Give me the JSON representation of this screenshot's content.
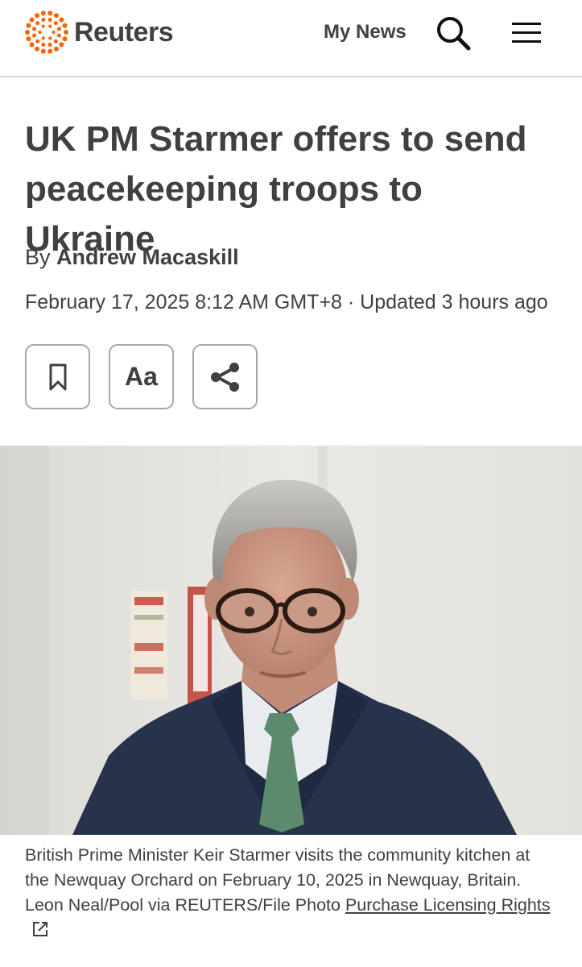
{
  "header": {
    "logo_text": "Reuters",
    "logo_icon": "reuters-dot-logo-icon",
    "my_news_label": "My News",
    "search_icon": "search-icon",
    "menu_icon": "hamburger-menu-icon"
  },
  "article": {
    "headline": "UK PM Starmer offers to send peacekeeping troops to Ukraine",
    "byline_prefix": "By",
    "author": "Andrew Macaskill",
    "date": "February 17, 2025 8:12 AM GMT+8 · Updated 3 hours ago"
  },
  "actions": {
    "bookmark_icon": "bookmark-icon",
    "text_size_label": "Aa",
    "share_icon": "share-icon"
  },
  "photo": {
    "caption": "British Prime Minister Keir Starmer visits the community kitchen at the Newquay Orchard on February 10, 2025 in Newquay, Britain. Leon Neal/Pool via REUTERS/File Photo",
    "licensing_link_text": "Purchase Licensing Rights",
    "external_link_icon": "external-link-icon"
  },
  "colors": {
    "brand_orange": "#fa6400",
    "text": "#404040",
    "divider": "#d6d6d6",
    "button_border": "#a8a8a8"
  }
}
